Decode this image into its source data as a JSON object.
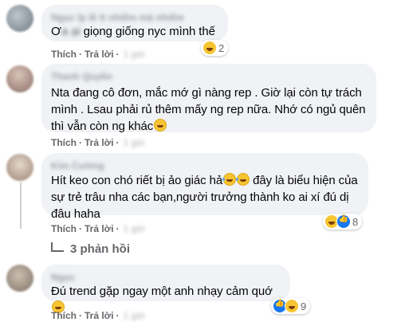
{
  "comments": [
    {
      "name": "Ngọc lp lề tt nhiếm mà nhiếm",
      "text_prefix": "Ơ",
      "text_blurred": "a ại",
      "text_rest": " giọng giống nyc mình thế",
      "like_label": "Thích",
      "reply_label": "Trả lời",
      "time": "1 giờ",
      "reaction_count": "2"
    },
    {
      "name": "Thanh Quyền",
      "text": "Nta đang cô đơn, mắc mớ gì nàng rep . Giờ lại còn tự trách mình . Lsau phải rủ thêm mấy ng rep nữa. Nhớ có ngủ quên thì vẫn còn ng khác",
      "like_label": "Thích",
      "reply_label": "Trả lời",
      "time": "1 giờ"
    },
    {
      "name": "Kim Cường",
      "text": "Hít keo con chó riết bị ảo giác hả",
      "text2": " đây là biểu hiện của sự trẻ trâu nha các bạn,người trưởng thành ko ai xí đú dị đâu haha",
      "like_label": "Thích",
      "reply_label": "Trả lời",
      "time": "1 giờ",
      "reaction_count": "8",
      "replies_label": "3 phản hồi"
    },
    {
      "name": "Ngọc",
      "text": "Đú trend gặp ngay một anh nhạy cảm quớ",
      "like_label": "Thích",
      "reply_label": "Trả lời",
      "time": "1 giờ",
      "reaction_count": "9"
    }
  ]
}
